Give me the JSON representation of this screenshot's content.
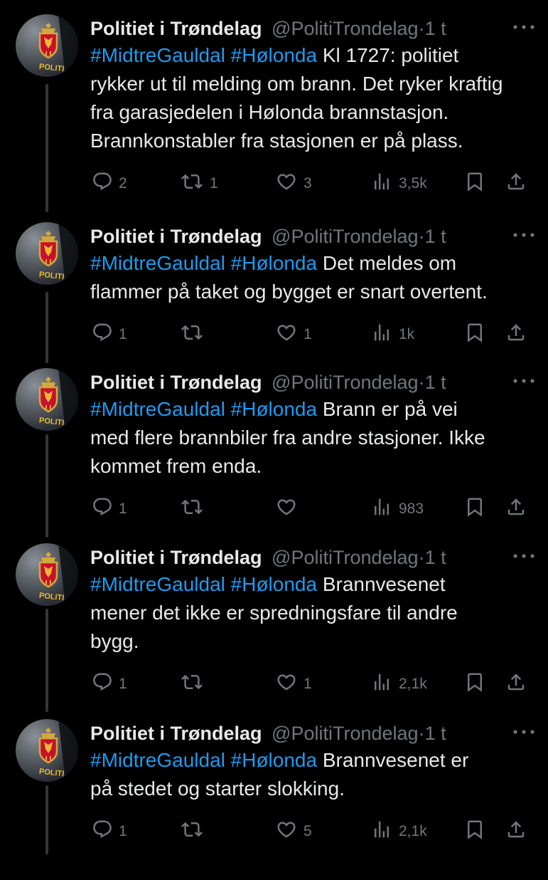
{
  "account": {
    "name": "Politiet i Trøndelag",
    "handle": "@PolitiTrondelag",
    "separator": "·",
    "avatar_badge": "POLITI"
  },
  "colors": {
    "background": "#000000",
    "text": "#e7e9ea",
    "muted": "#71767b",
    "hashtag": "#1d9bf0",
    "thread_line": "#333639"
  },
  "tweets": [
    {
      "time": "1 t",
      "tags": [
        "#MidtreGauldal",
        "#Hølonda"
      ],
      "lines": [
        {
          "tags": "#MidtreGauldal #Hølonda",
          "text": " Kl 1727:  politiet"
        },
        {
          "tags": "",
          "text": "rykker ut til melding om brann. Det ryker kraftig"
        },
        {
          "tags": "",
          "text": "fra garasjedelen i Hølonda brannstasjon."
        },
        {
          "tags": "",
          "text": "Brannkonstabler fra stasjonen er på plass."
        }
      ],
      "replies": "2",
      "reposts": "1",
      "likes": "3",
      "views": "3,5k"
    },
    {
      "time": "1 t",
      "lines": [
        {
          "tags": "#MidtreGauldal #Hølonda",
          "text": " Det meldes om"
        },
        {
          "tags": "",
          "text": "flammer på taket og bygget er snart overtent."
        }
      ],
      "replies": "1",
      "reposts": "",
      "likes": "1",
      "views": "1k"
    },
    {
      "time": "1 t",
      "lines": [
        {
          "tags": "#MidtreGauldal #Hølonda",
          "text": " Brann er på vei"
        },
        {
          "tags": "",
          "text": "med flere brannbiler fra andre stasjoner. Ikke"
        },
        {
          "tags": "",
          "text": "kommet frem enda."
        }
      ],
      "replies": "1",
      "reposts": "",
      "likes": "",
      "views": "983"
    },
    {
      "time": "1 t",
      "lines": [
        {
          "tags": "#MidtreGauldal #Hølonda",
          "text": " Brannvesenet"
        },
        {
          "tags": "",
          "text": "mener det ikke er spredningsfare til andre"
        },
        {
          "tags": "",
          "text": "bygg."
        }
      ],
      "replies": "1",
      "reposts": "",
      "likes": "1",
      "views": "2,1k"
    },
    {
      "time": "1 t",
      "lines": [
        {
          "tags": "#MidtreGauldal #Hølonda",
          "text": " Brannvesenet er"
        },
        {
          "tags": "",
          "text": "på stedet og starter slokking."
        }
      ],
      "replies": "1",
      "reposts": "",
      "likes": "5",
      "views": "2,1k"
    }
  ]
}
